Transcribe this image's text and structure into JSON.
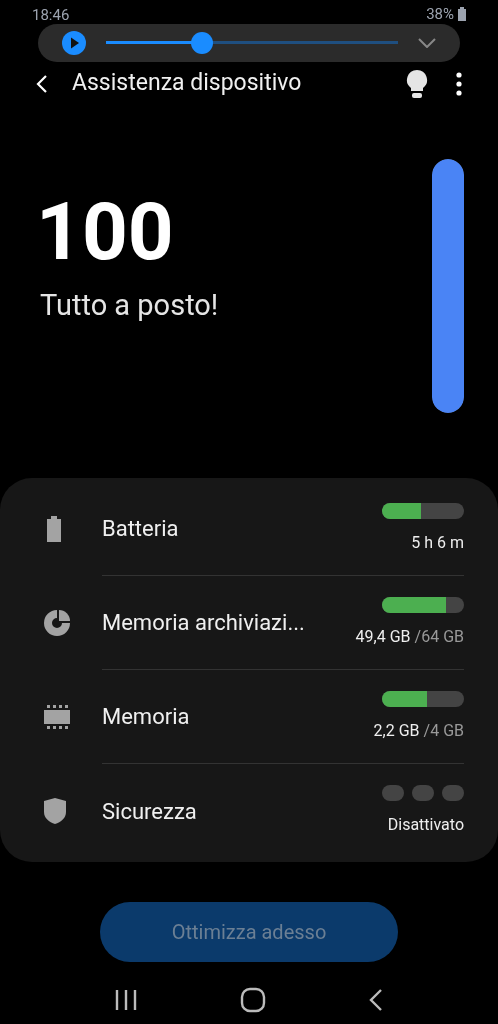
{
  "status_bar": {
    "time": "18:46",
    "battery": "38%"
  },
  "media_overlay": {
    "level": 0.33
  },
  "app_bar": {
    "title": "Assistenza dispositivo"
  },
  "score": {
    "value": "100",
    "message": "Tutto a posto!",
    "level": 1
  },
  "items": [
    {
      "kind": "bar",
      "label": "Batteria",
      "level": 0.47,
      "value": "5 h 6 m"
    },
    {
      "kind": "bar",
      "label": "Memoria archiviazi...",
      "level": 0.78,
      "value": "49,4 GB",
      "total": "/64 GB"
    },
    {
      "kind": "bar",
      "label": "Memoria",
      "level": 0.55,
      "value": "2,2 GB",
      "total": "/4 GB"
    },
    {
      "kind": "dots",
      "label": "Sicurezza",
      "value": "Disattivato"
    }
  ],
  "optimize_button": {
    "label": "Ottimizza adesso",
    "disabled": true
  }
}
